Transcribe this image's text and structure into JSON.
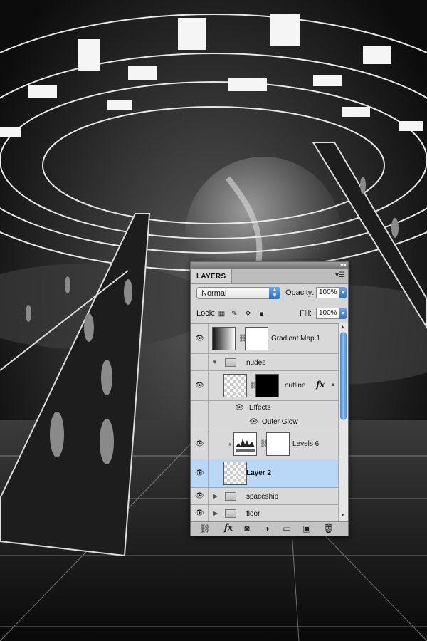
{
  "panel": {
    "tab_label": "LAYERS",
    "blend_mode": "Normal",
    "opacity_label": "Opacity:",
    "opacity_value": "100%",
    "lock_label": "Lock:",
    "fill_label": "Fill:",
    "fill_value": "100%"
  },
  "layers": [
    {
      "name": "Gradient Map 1",
      "type": "adjustment",
      "visible": true
    },
    {
      "name": "nudes",
      "type": "group",
      "expanded": true,
      "visible": false
    },
    {
      "name": "outline",
      "type": "layer-with-mask",
      "visible": true,
      "has_fx": true
    },
    {
      "name": "Effects",
      "type": "effects",
      "visible": true
    },
    {
      "name": "Outer Glow",
      "type": "effect",
      "visible": true
    },
    {
      "name": "Levels 6",
      "type": "adjustment",
      "clipped": true,
      "visible": true
    },
    {
      "name": "Layer 2",
      "type": "layer",
      "selected": true,
      "visible": true
    },
    {
      "name": "spaceship",
      "type": "group",
      "expanded": false,
      "visible": true
    },
    {
      "name": "floor",
      "type": "group",
      "expanded": false,
      "visible": true
    }
  ],
  "icons": {
    "eye": "eye-icon",
    "chain": "link-icon",
    "folder": "folder-icon",
    "fx": "fx-icon"
  },
  "colors": {
    "selected_row": "#b9d7f7",
    "scroll_thumb": "#5a9de3",
    "panel_bg": "#d6d6d6"
  }
}
